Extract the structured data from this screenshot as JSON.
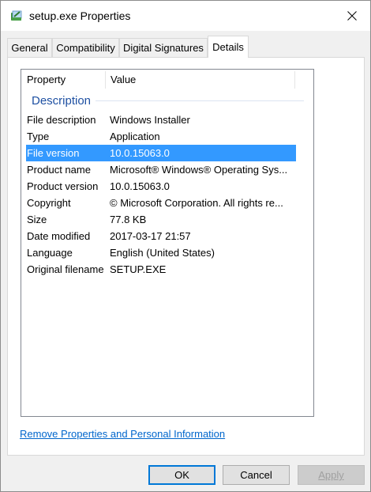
{
  "window": {
    "title": "setup.exe Properties",
    "icon": "installer-icon"
  },
  "tabs": [
    {
      "label": "General"
    },
    {
      "label": "Compatibility"
    },
    {
      "label": "Digital Signatures"
    },
    {
      "label": "Details",
      "active": true
    }
  ],
  "details": {
    "columns": {
      "property": "Property",
      "value": "Value"
    },
    "group": "Description",
    "rows": [
      {
        "property": "File description",
        "value": "Windows Installer"
      },
      {
        "property": "Type",
        "value": "Application"
      },
      {
        "property": "File version",
        "value": "10.0.15063.0",
        "selected": true
      },
      {
        "property": "Product name",
        "value": "Microsoft® Windows® Operating Sys..."
      },
      {
        "property": "Product version",
        "value": "10.0.15063.0"
      },
      {
        "property": "Copyright",
        "value": "© Microsoft Corporation. All rights re..."
      },
      {
        "property": "Size",
        "value": "77.8 KB"
      },
      {
        "property": "Date modified",
        "value": "2017-03-17 21:57"
      },
      {
        "property": "Language",
        "value": "English (United States)"
      },
      {
        "property": "Original filename",
        "value": "SETUP.EXE"
      }
    ]
  },
  "link": {
    "remove_properties": "Remove Properties and Personal Information"
  },
  "buttons": {
    "ok": "OK",
    "cancel": "Cancel",
    "apply": "Apply"
  },
  "colors": {
    "selection": "#3399ff",
    "link": "#0066cc",
    "group_header": "#1e50a2",
    "ok_border": "#0078d7"
  }
}
